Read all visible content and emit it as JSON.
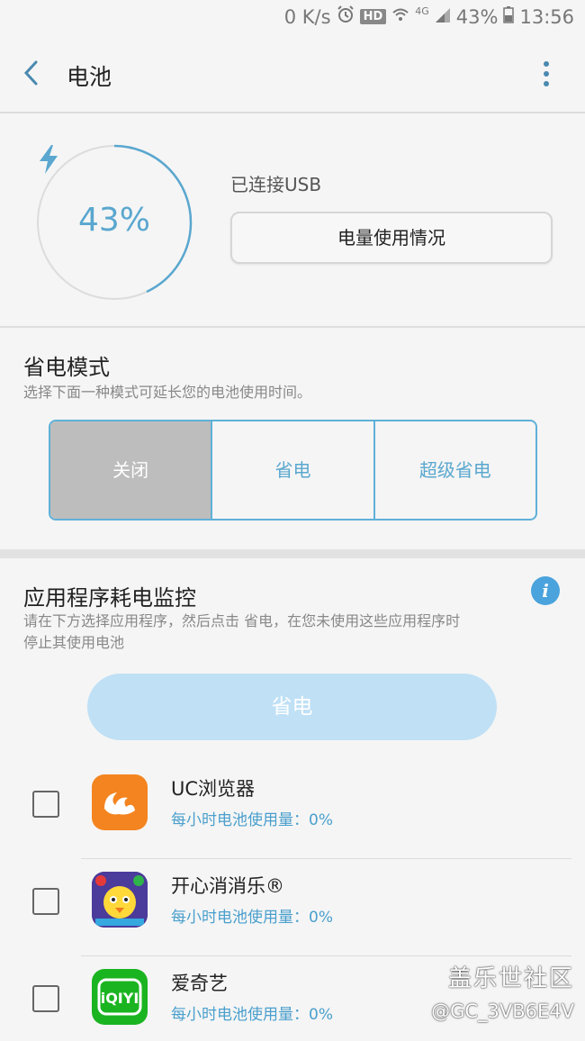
{
  "status_bar": {
    "net_speed": "0 K/s",
    "hd_badge": "HD",
    "network": "4G",
    "battery": "43%",
    "time": "13:56"
  },
  "app_bar": {
    "title": "电池"
  },
  "battery": {
    "level_text": "43%",
    "level_fraction": 0.43,
    "connection_status": "已连接USB",
    "usage_button": "电量使用情况",
    "ring_color": "#5aa7cf"
  },
  "power_mode": {
    "title": "省电模式",
    "description": "选择下面一种模式可延长您的电池使用时间。",
    "options": [
      "关闭",
      "省电",
      "超级省电"
    ],
    "selected": "关闭"
  },
  "app_monitor": {
    "title": "应用程序耗电监控",
    "description_line1": "请在下方选择应用程序，然后点击 省电，在您未使用这些应用程序时",
    "description_line2": "停止其使用电池",
    "save_button": "省电",
    "apps": [
      {
        "name": "UC浏览器",
        "usage": "每小时电池使用量：0%",
        "icon": "uc-browser-icon",
        "checked": false
      },
      {
        "name": "开心消消乐®",
        "usage": "每小时电池使用量：0%",
        "icon": "happy-elimination-icon",
        "checked": false
      },
      {
        "name": "爱奇艺",
        "usage": "每小时电池使用量：0%",
        "icon": "iqiyi-icon",
        "checked": false
      }
    ]
  },
  "watermark": {
    "line1": "盖乐世社区",
    "line2": "@GC_3VB6E4V"
  },
  "colors": {
    "accent": "#5aa7cf",
    "button_disabled": "#bfe0f5",
    "info_icon": "#4aa3dc"
  }
}
